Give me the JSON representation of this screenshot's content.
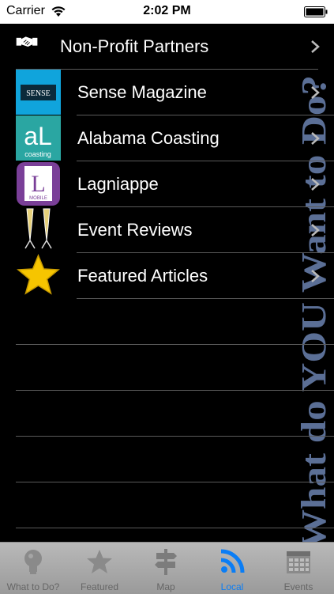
{
  "status_bar": {
    "carrier": "Carrier",
    "time": "2:02 PM"
  },
  "watermark": {
    "text": "What do YOU Want to Do?"
  },
  "list": {
    "items": [
      {
        "label": "Non-Profit Partners",
        "icon": "handshake-icon"
      },
      {
        "label": "Sense Magazine",
        "icon": "sense-magazine-logo",
        "logo_text": "SENSE"
      },
      {
        "label": "Alabama Coasting",
        "icon": "alabama-coasting-logo",
        "logo_text": "aL",
        "logo_sub": "coasting"
      },
      {
        "label": "Lagniappe",
        "icon": "lagniappe-logo",
        "logo_text": "L",
        "logo_sub": "MOBILE"
      },
      {
        "label": "Event Reviews",
        "icon": "champagne-glasses-icon"
      },
      {
        "label": "Featured Articles",
        "icon": "star-icon"
      }
    ]
  },
  "tab_bar": {
    "tabs": [
      {
        "label": "What to Do?",
        "icon": "lightbulb-icon",
        "active": false
      },
      {
        "label": "Featured",
        "icon": "star-icon",
        "active": false
      },
      {
        "label": "Map",
        "icon": "signpost-icon",
        "active": false
      },
      {
        "label": "Local",
        "icon": "broadcast-icon",
        "active": true
      },
      {
        "label": "Events",
        "icon": "calendar-icon",
        "active": false
      }
    ]
  },
  "colors": {
    "accent": "#0a7df5",
    "background": "#000000",
    "watermark": "#5b6f96"
  }
}
